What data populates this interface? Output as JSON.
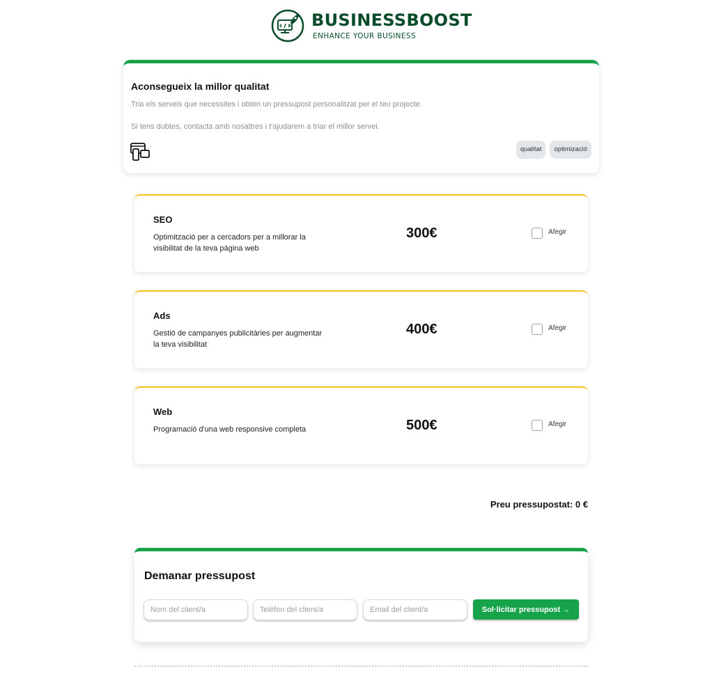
{
  "header": {
    "brand": "BUSINESSBOOST",
    "tagline": "ENHANCE YOUR BUSINESS",
    "logo_icon": "rocket-monitor-icon",
    "brand_color": "#0b4d2b"
  },
  "intro": {
    "title": "Aconsegueix la millor qualitat",
    "paragraph1": "Tria els serveis que necessites i obtén un pressupost personalitzat per el teu projecte.",
    "paragraph2": "Si tens dubtes, contacta amb nosaltres i t'ajudarem a triar el millor servei.",
    "icon": "responsive-devices-icon",
    "tags": [
      "qualitat",
      "optimizació"
    ],
    "accent_color": "#16a34a"
  },
  "services": [
    {
      "name": "SEO",
      "description": "Optimització per a cercadors per a millorar la visibilitat de la teva página web",
      "price": "300€",
      "add_label": "Afegir",
      "checked": false
    },
    {
      "name": "Ads",
      "description": "Gestió de campanyes publicitàries per augmentar la teva visibilitat",
      "price": "400€",
      "add_label": "Afegir",
      "checked": false
    },
    {
      "name": "Web",
      "description": "Programació d'una web responsive completa",
      "price": "500€",
      "add_label": "Afegir",
      "checked": false
    }
  ],
  "service_accent_color": "#f3c21b",
  "total": {
    "label": "Preu pressupostat: 0 €"
  },
  "request": {
    "title": "Demanar pressupost",
    "name_placeholder": "Nom del client/a",
    "phone_placeholder": "Teléfon del client/a",
    "email_placeholder": "Email del client/a",
    "button_label": "Sol·licitar pressupost →",
    "button_color": "#16a34a"
  }
}
